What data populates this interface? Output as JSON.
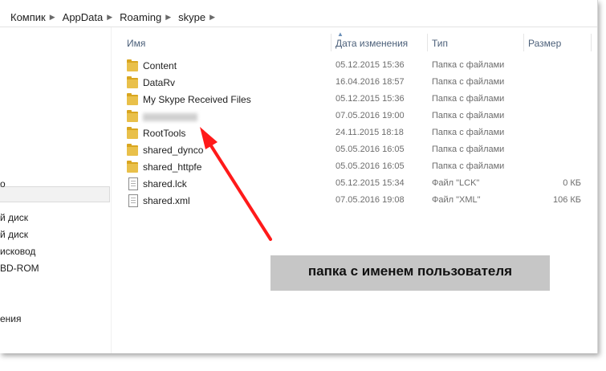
{
  "address_bar": {
    "crumbs": [
      "Компик",
      "AppData",
      "Roaming",
      "skype"
    ]
  },
  "columns": {
    "name": "Имя",
    "date": "Дата изменения",
    "type": "Тип",
    "size": "Размер"
  },
  "sidebar": {
    "items": [
      "о",
      "й диск",
      "й диск",
      "исковод",
      "BD-ROM",
      "ения"
    ]
  },
  "files": [
    {
      "name": "Content",
      "date": "05.12.2015 15:36",
      "type": "Папка с файлами",
      "size": "",
      "kind": "folder"
    },
    {
      "name": "DataRv",
      "date": "16.04.2016 18:57",
      "type": "Папка с файлами",
      "size": "",
      "kind": "folder"
    },
    {
      "name": "My Skype Received Files",
      "date": "05.12.2015 15:36",
      "type": "Папка с файлами",
      "size": "",
      "kind": "folder"
    },
    {
      "name": "",
      "date": "07.05.2016 19:00",
      "type": "Папка с файлами",
      "size": "",
      "kind": "folder-hidden-name"
    },
    {
      "name": "RootTools",
      "date": "24.11.2015 18:18",
      "type": "Папка с файлами",
      "size": "",
      "kind": "folder"
    },
    {
      "name": "shared_dynco",
      "date": "05.05.2016 16:05",
      "type": "Папка с файлами",
      "size": "",
      "kind": "folder"
    },
    {
      "name": "shared_httpfe",
      "date": "05.05.2016 16:05",
      "type": "Папка с файлами",
      "size": "",
      "kind": "folder"
    },
    {
      "name": "shared.lck",
      "date": "05.12.2015 15:34",
      "type": "Файл \"LCK\"",
      "size": "0 КБ",
      "kind": "file"
    },
    {
      "name": "shared.xml",
      "date": "07.05.2016 19:08",
      "type": "Файл \"XML\"",
      "size": "106 КБ",
      "kind": "file"
    }
  ],
  "annotation": {
    "text": "папка с именем пользователя",
    "arrow_color": "#ff1a1a"
  }
}
